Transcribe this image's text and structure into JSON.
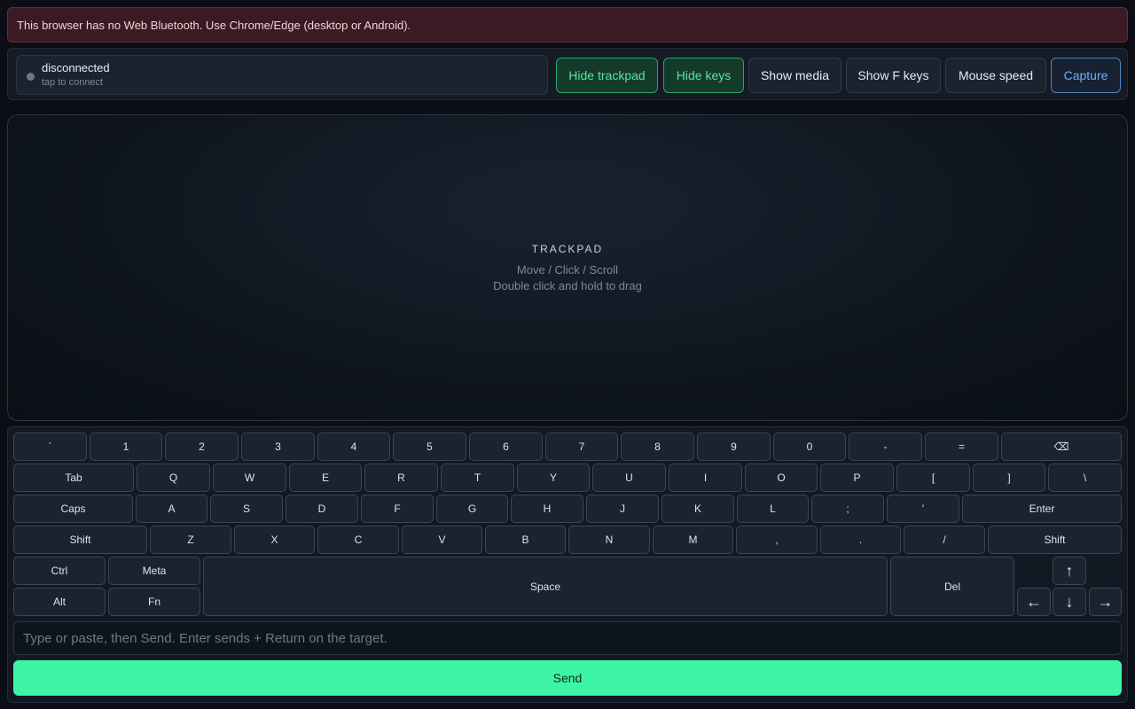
{
  "banner": {
    "text": "This browser has no Web Bluetooth. Use Chrome/Edge (desktop or Android)."
  },
  "connection": {
    "status": "disconnected",
    "hint": "tap to connect",
    "dot_color": "#6f7782"
  },
  "toolbar": {
    "hide_trackpad": "Hide trackpad",
    "hide_keys": "Hide keys",
    "show_media": "Show media",
    "show_fkeys": "Show F keys",
    "mouse_speed": "Mouse speed",
    "capture": "Capture"
  },
  "trackpad": {
    "title": "TRACKPAD",
    "line1": "Move / Click / Scroll",
    "line2": "Double click and hold to drag"
  },
  "keyboard": {
    "row1": [
      "`",
      "1",
      "2",
      "3",
      "4",
      "5",
      "6",
      "7",
      "8",
      "9",
      "0",
      "-",
      "=",
      "⌫"
    ],
    "row2": [
      "Tab",
      "Q",
      "W",
      "E",
      "R",
      "T",
      "Y",
      "U",
      "I",
      "O",
      "P",
      "[",
      "]",
      "\\"
    ],
    "row3": [
      "Caps",
      "A",
      "S",
      "D",
      "F",
      "G",
      "H",
      "J",
      "K",
      "L",
      ";",
      "'",
      "Enter"
    ],
    "row4": [
      "Shift",
      "Z",
      "X",
      "C",
      "V",
      "B",
      "N",
      "M",
      ",",
      ".",
      "/",
      "Shift"
    ],
    "bottom": {
      "ctrl": "Ctrl",
      "meta": "Meta",
      "alt": "Alt",
      "fn": "Fn",
      "space": "Space",
      "del": "Del",
      "up": "↑",
      "left": "←",
      "down": "↓",
      "right": "→"
    }
  },
  "input": {
    "placeholder": "Type or paste, then Send. Enter sends + Return on the target.",
    "value": ""
  },
  "send": {
    "label": "Send"
  },
  "colors": {
    "accent": "#3ef5a6",
    "active_text": "#5ee3a2",
    "capture_outline": "#4f86c6",
    "banner_bg": "#3b1a23"
  }
}
